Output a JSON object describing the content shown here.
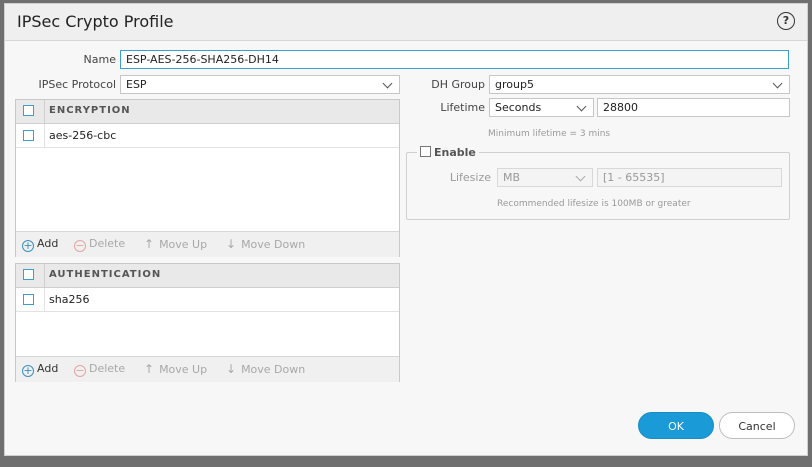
{
  "dialog": {
    "title": "IPSec Crypto Profile",
    "help_symbol": "?"
  },
  "form": {
    "name_label": "Name",
    "name_value": "ESP-AES-256-SHA256-DH14",
    "protocol_label": "IPSec Protocol",
    "protocol_value": "ESP",
    "dh_group_label": "DH Group",
    "dh_group_value": "group5",
    "lifetime_label": "Lifetime",
    "lifetime_unit": "Seconds",
    "lifetime_value": "28800",
    "lifetime_hint": "Minimum lifetime = 3 mins"
  },
  "lifesize": {
    "enable_label": "Enable",
    "enabled": false,
    "label": "Lifesize",
    "unit": "MB",
    "placeholder": "[1 - 65535]",
    "hint": "Recommended lifesize is 100MB or greater"
  },
  "encryption": {
    "header": "ENCRYPTION",
    "rows": [
      "aes-256-cbc"
    ]
  },
  "authentication": {
    "header": "AUTHENTICATION",
    "rows": [
      "sha256"
    ]
  },
  "toolbar": {
    "add": "Add",
    "delete": "Delete",
    "move_up": "Move Up",
    "move_down": "Move Down"
  },
  "buttons": {
    "ok": "OK",
    "cancel": "Cancel"
  },
  "colors": {
    "accent": "#1a9ad7",
    "checkbox": "#3a9fcc"
  },
  "icons": {
    "help": "help-circle-icon",
    "add": "plus-circle-icon",
    "delete": "minus-circle-icon",
    "move_up": "arrow-up-icon",
    "move_down": "arrow-down-icon"
  }
}
